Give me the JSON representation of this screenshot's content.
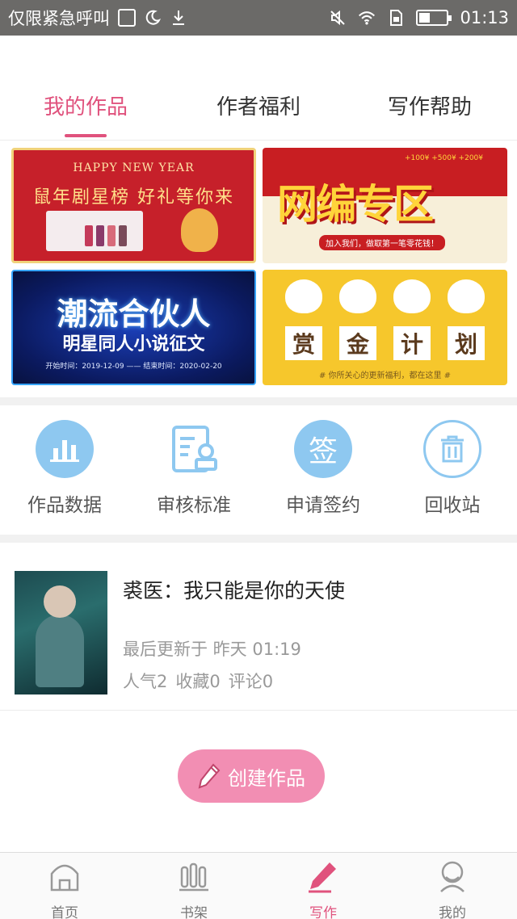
{
  "status_bar": {
    "notification_text": "仅限紧急呼叫",
    "time": "01:13",
    "icons": [
      "gallery-icon",
      "moon-icon",
      "download-icon",
      "mute-icon",
      "wifi-icon",
      "sim-icon",
      "battery-icon"
    ],
    "battery_level": 0.4
  },
  "tabs": [
    {
      "label": "我的作品",
      "active": true
    },
    {
      "label": "作者福利",
      "active": false
    },
    {
      "label": "写作帮助",
      "active": false
    }
  ],
  "banners": {
    "new_year": {
      "heading": "HAPPY NEW YEAR",
      "slogan": "鼠年剧星榜 好礼等你来"
    },
    "web_novel": {
      "title": "网编专区",
      "subtitle": "加入我们，做取第一笔零花钱！",
      "bonus": "+100¥ +500¥ +200¥"
    },
    "trend": {
      "title": "潮流合伙人",
      "subtitle": "明星同人小说征文",
      "dates": "开始时间：2019-12-09 —— 结束时间：2020-02-20"
    },
    "bounty": {
      "chars": [
        "赏",
        "金",
        "计",
        "划"
      ],
      "note": "# 你所关心的更新福利，都在这里 #"
    }
  },
  "actions": [
    {
      "label": "作品数据",
      "icon": "bar-chart-icon"
    },
    {
      "label": "审核标准",
      "icon": "document-stamp-icon"
    },
    {
      "label": "申请签约",
      "icon": "sign-icon",
      "icon_text": "签"
    },
    {
      "label": "回收站",
      "icon": "trash-icon"
    }
  ],
  "work": {
    "title": "裘医：我只能是你的天使",
    "updated": "最后更新于 昨天 01:19",
    "stats": [
      "人气2",
      "收藏0",
      "评论0"
    ]
  },
  "create_button": {
    "label": "创建作品",
    "icon": "pencil-icon"
  },
  "bottom_nav": [
    {
      "label": "首页",
      "icon": "home-icon",
      "active": false
    },
    {
      "label": "书架",
      "icon": "bookshelf-icon",
      "active": false
    },
    {
      "label": "写作",
      "icon": "pencil-icon",
      "active": true
    },
    {
      "label": "我的",
      "icon": "profile-icon",
      "active": false
    }
  ],
  "colors": {
    "accent": "#e0527d",
    "action_blue": "#8ec8f0",
    "create_pink": "#f28eb3"
  }
}
